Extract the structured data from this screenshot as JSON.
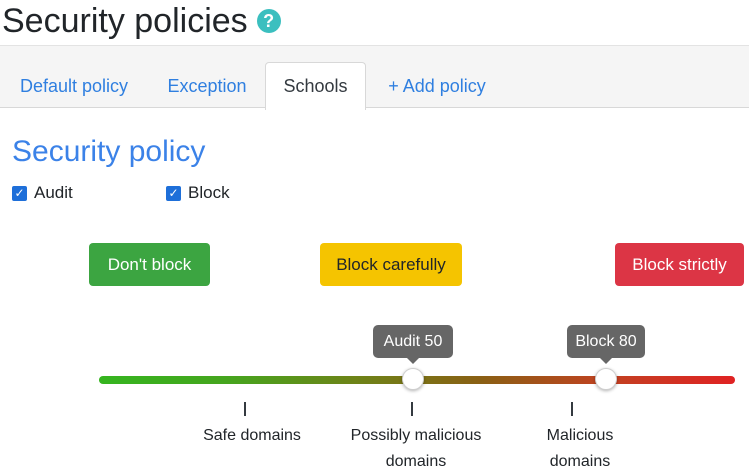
{
  "page": {
    "title": "Security policies",
    "help_icon": "question-mark"
  },
  "tabs": [
    {
      "label": "Default policy",
      "active": false
    },
    {
      "label": "Exception",
      "active": false
    },
    {
      "label": "Schools",
      "active": true
    },
    {
      "label": "+ Add policy",
      "active": false
    }
  ],
  "section": {
    "title": "Security policy"
  },
  "checkboxes": {
    "audit": {
      "label": "Audit",
      "checked": true
    },
    "block": {
      "label": "Block",
      "checked": true
    }
  },
  "policy_buttons": {
    "dont_block": {
      "label": "Don't block",
      "color": "#3ca541",
      "text_color": "#ffffff"
    },
    "block_carefully": {
      "label": "Block carefully",
      "color": "#f5c400",
      "text_color": "#212529"
    },
    "block_strictly": {
      "label": "Block strictly",
      "color": "#dc3545",
      "text_color": "#ffffff"
    }
  },
  "slider": {
    "audit": {
      "label": "Audit 50",
      "value": 50
    },
    "block": {
      "label": "Block 80",
      "value": 80
    },
    "gradient_colors": [
      "#35b51f",
      "#e02223"
    ]
  },
  "scale_labels": {
    "safe": "Safe domains",
    "possibly_malicious_line1": "Possibly malicious",
    "possibly_malicious_line2": "domains",
    "malicious_line1": "Malicious",
    "malicious_line2": "domains"
  }
}
